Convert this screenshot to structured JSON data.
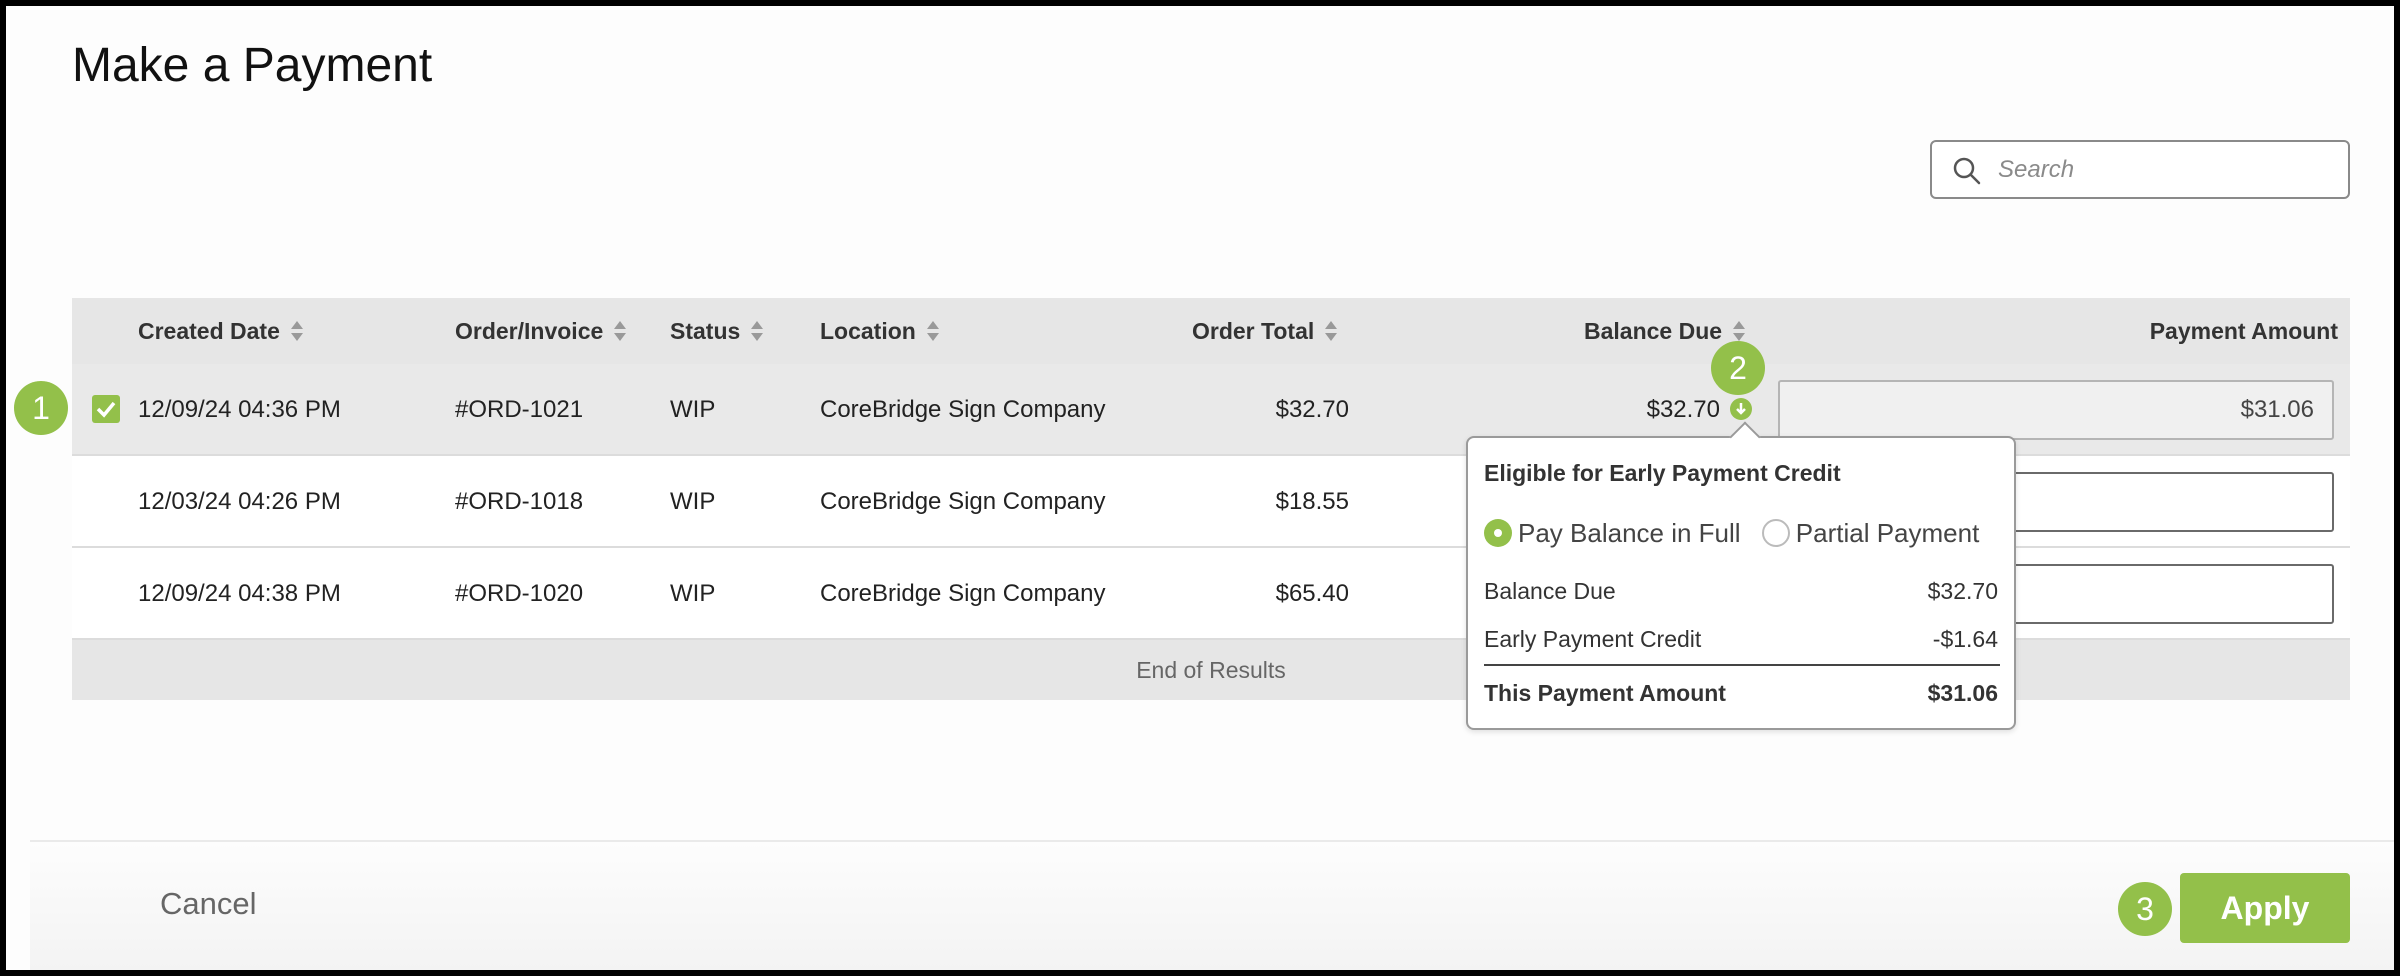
{
  "page": {
    "title": "Make a Payment"
  },
  "search": {
    "placeholder": "Search"
  },
  "table": {
    "columns": [
      {
        "label": "Created Date"
      },
      {
        "label": "Order/Invoice"
      },
      {
        "label": "Status"
      },
      {
        "label": "Location"
      },
      {
        "label": "Order Total"
      },
      {
        "label": "Balance Due"
      },
      {
        "label": "Payment Amount"
      }
    ],
    "rows": [
      {
        "selected": true,
        "created": "12/09/24 04:36 PM",
        "order": "#ORD-1021",
        "status": "WIP",
        "location": "CoreBridge Sign Company",
        "order_total": "$32.70",
        "balance_due": "$32.70",
        "payment_amount": "$31.06"
      },
      {
        "selected": false,
        "created": "12/03/24 04:26 PM",
        "order": "#ORD-1018",
        "status": "WIP",
        "location": "CoreBridge Sign Company",
        "order_total": "$18.55",
        "balance_due": "",
        "payment_amount": ""
      },
      {
        "selected": false,
        "created": "12/09/24 04:38 PM",
        "order": "#ORD-1020",
        "status": "WIP",
        "location": "CoreBridge Sign Company",
        "order_total": "$65.40",
        "balance_due": "",
        "payment_amount": ""
      }
    ],
    "end_text": "End of Results"
  },
  "popover": {
    "title": "Eligible for Early Payment Credit",
    "options": [
      "Pay Balance in Full",
      "Partial Payment"
    ],
    "selected_option": "Pay Balance in Full",
    "lines": [
      {
        "label": "Balance Due",
        "value": "$32.70"
      },
      {
        "label": "Early Payment Credit",
        "value": "-$1.64"
      }
    ],
    "total": {
      "label": "This Payment Amount",
      "value": "$31.06"
    }
  },
  "footer": {
    "cancel_label": "Cancel",
    "apply_label": "Apply"
  },
  "steps": [
    "1",
    "2",
    "3"
  ],
  "colors": {
    "accent": "#93c04a"
  }
}
